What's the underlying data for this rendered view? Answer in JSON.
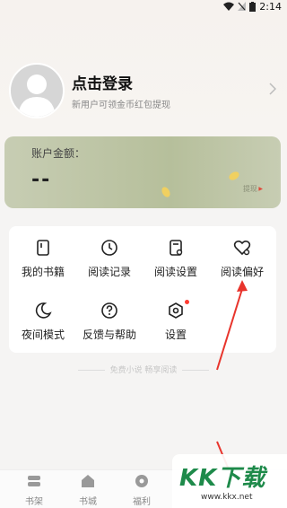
{
  "status": {
    "time": "2:14"
  },
  "profile": {
    "title": "点击登录",
    "subtitle": "新用户可领金币红包提现"
  },
  "balance": {
    "label": "账户金额：",
    "value": "--",
    "withdraw": "提现"
  },
  "menu": [
    {
      "label": "我的书籍",
      "icon": "book-icon"
    },
    {
      "label": "阅读记录",
      "icon": "clock-icon"
    },
    {
      "label": "阅读设置",
      "icon": "settings-doc-icon"
    },
    {
      "label": "阅读偏好",
      "icon": "heart-icon"
    },
    {
      "label": "夜间模式",
      "icon": "moon-icon"
    },
    {
      "label": "反馈与帮助",
      "icon": "help-icon"
    },
    {
      "label": "设置",
      "icon": "hexagon-settings-icon"
    }
  ],
  "slogan": "免费小说 畅享阅读",
  "tabs": [
    {
      "label": "书架",
      "icon": "shelf-icon"
    },
    {
      "label": "书城",
      "icon": "store-icon"
    },
    {
      "label": "福利",
      "icon": "gift-icon"
    }
  ],
  "watermark": {
    "brand": "KK下载",
    "url": "www.kkx.net"
  },
  "colors": {
    "annotation_arrow": "#e8342c",
    "badge": "#ff3b30",
    "card_green": "#b6bf9b"
  }
}
